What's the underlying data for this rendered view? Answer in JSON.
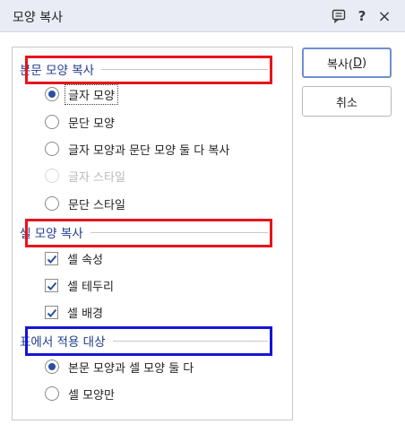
{
  "window": {
    "title": "모양 복사",
    "help_label": "?",
    "close_label": "×"
  },
  "sections": {
    "body": "본문 모양 복사",
    "cell": "셀 모양 복사",
    "table": "표에서 적용 대상"
  },
  "body_options": [
    {
      "label": "글자 모양",
      "selected": true
    },
    {
      "label": "문단 모양",
      "selected": false
    },
    {
      "label": "글자 모양과 문단 모양 둘 다 복사",
      "selected": false
    },
    {
      "label": "글자 스타일",
      "selected": false,
      "disabled": true
    },
    {
      "label": "문단 스타일",
      "selected": false
    }
  ],
  "cell_options": [
    {
      "label": "셀 속성",
      "checked": true
    },
    {
      "label": "셀 테두리",
      "checked": true
    },
    {
      "label": "셀 배경",
      "checked": true
    }
  ],
  "table_options": [
    {
      "label": "본문 모양과 셀 모양 둘 다",
      "selected": true
    },
    {
      "label": "셀 모양만",
      "selected": false
    }
  ],
  "buttons": {
    "copy_prefix": "복사(",
    "copy_key": "D",
    "copy_suffix": ")",
    "cancel": "취소"
  },
  "highlight_colors": {
    "red": "#e8141b",
    "blue": "#1515d6"
  }
}
